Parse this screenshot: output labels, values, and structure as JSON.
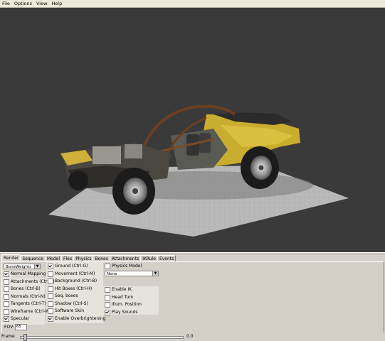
{
  "menu": [
    "File",
    "Options",
    "View",
    "Help"
  ],
  "tabs": [
    "Render",
    "Sequence",
    "Model",
    "Flex",
    "Physics",
    "Bones",
    "Attachments",
    "IKRule",
    "Events"
  ],
  "render_mode": {
    "selected": "BoneWeights"
  },
  "col1": [
    {
      "label": "Normal Mapping",
      "checked": true
    },
    {
      "label": "Attachments (Ctrl-A)",
      "checked": false
    },
    {
      "label": "Bones (Ctrl-B)",
      "checked": false
    },
    {
      "label": "Normals (Ctrl-N)",
      "checked": false
    },
    {
      "label": "Tangents (Ctrl-T)",
      "checked": false
    },
    {
      "label": "Wireframe (Ctrl-W)",
      "checked": false
    },
    {
      "label": "Specular",
      "checked": true
    }
  ],
  "col2": [
    {
      "label": "Ground (Ctrl-G)",
      "checked": true
    },
    {
      "label": "Movement (Ctrl-M)",
      "checked": false
    },
    {
      "label": "Background (Ctrl-B)",
      "checked": false
    },
    {
      "label": "Hit Boxes (Ctrl-H)",
      "checked": false
    },
    {
      "label": "Seq. boxes",
      "checked": false
    },
    {
      "label": "Shadow (Ctrl-S)",
      "checked": false
    },
    {
      "label": "Software Skin",
      "checked": false
    },
    {
      "label": "Enable Overbrightening",
      "checked": true
    }
  ],
  "col3_top": {
    "label": "Physics Model",
    "checked": false
  },
  "physics_select": {
    "selected": "None"
  },
  "col3": [
    {
      "label": "Enable IK",
      "checked": false
    },
    {
      "label": "Head Turn",
      "checked": false
    },
    {
      "label": "Illum. Position",
      "checked": false
    },
    {
      "label": "Play Sounds",
      "checked": true
    }
  ],
  "fov": {
    "label": "FOV:",
    "value": "65"
  },
  "timebar": {
    "label": "Frame",
    "value": "0.0",
    "position": 0.02
  },
  "colors": {
    "viewport_bg": "#3a3a3a",
    "ground": "#b8b8b8",
    "car_yellow": "#d4b62e"
  }
}
